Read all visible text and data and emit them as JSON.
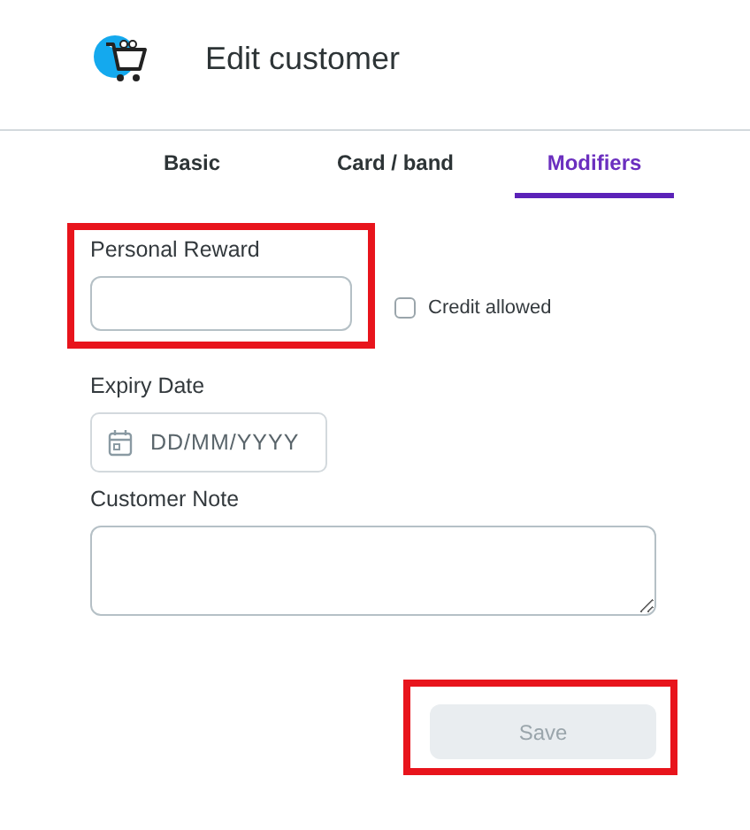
{
  "header": {
    "title": "Edit customer"
  },
  "tabs": [
    {
      "label": "Basic",
      "selected": false
    },
    {
      "label": "Card / band",
      "selected": false
    },
    {
      "label": "Modifiers",
      "selected": true
    }
  ],
  "personal_reward": {
    "label": "Personal Reward",
    "highlighted": true
  },
  "credit_allowed": {
    "label": "Credit allowed",
    "checked": false
  },
  "expiry_date": {
    "label": "Expiry Date",
    "placeholder": "DD/MM/YYYY"
  },
  "customer_note": {
    "label": "Customer Note"
  },
  "save_button": {
    "label": "Save",
    "disabled": true,
    "highlighted": true
  }
}
